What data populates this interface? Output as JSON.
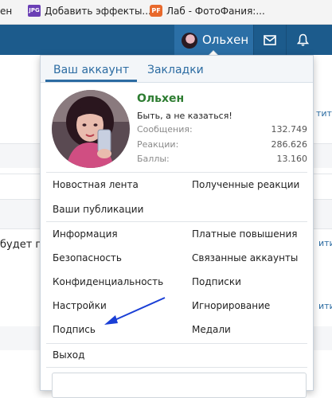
{
  "bookmarks": [
    {
      "label": "ен",
      "icon": "page-cut-icon"
    },
    {
      "label": "Добавить эффекты...",
      "icon": "jpg-favicon-icon"
    },
    {
      "label": "Лаб - ФотоФания:...",
      "icon": "photofania-favicon-icon"
    }
  ],
  "navbar": {
    "username": "Ольхен",
    "accent_color": "#1c5b8c",
    "icons": [
      "inbox-icon",
      "bell-icon"
    ]
  },
  "background_page": {
    "texts": [
      "будет п"
    ],
    "link_fragments": [
      "тити",
      "ити",
      "ити"
    ]
  },
  "menu": {
    "tabs": [
      {
        "label": "Ваш аккаунт",
        "active": true
      },
      {
        "label": "Закладки",
        "active": false
      }
    ],
    "profile": {
      "name": "Ольхен",
      "status": "Быть, а не казаться!",
      "stats": [
        {
          "label": "Сообщения:",
          "value": "132.749"
        },
        {
          "label": "Реакции:",
          "value": "286.626"
        },
        {
          "label": "Баллы:",
          "value": "13.160"
        }
      ]
    },
    "group1": {
      "left": [
        "Новостная лента",
        "Ваши публикации"
      ],
      "right": [
        "Полученные реакции"
      ]
    },
    "group2": {
      "left": [
        "Информация",
        "Безопасность",
        "Конфиденциальность",
        "Настройки",
        "Подпись"
      ],
      "right": [
        "Платные повышения",
        "Связанные аккаунты",
        "Подписки",
        "Игнорирование",
        "Медали"
      ]
    },
    "logout": "Выход"
  },
  "annotation_color": "#1a3fd6"
}
